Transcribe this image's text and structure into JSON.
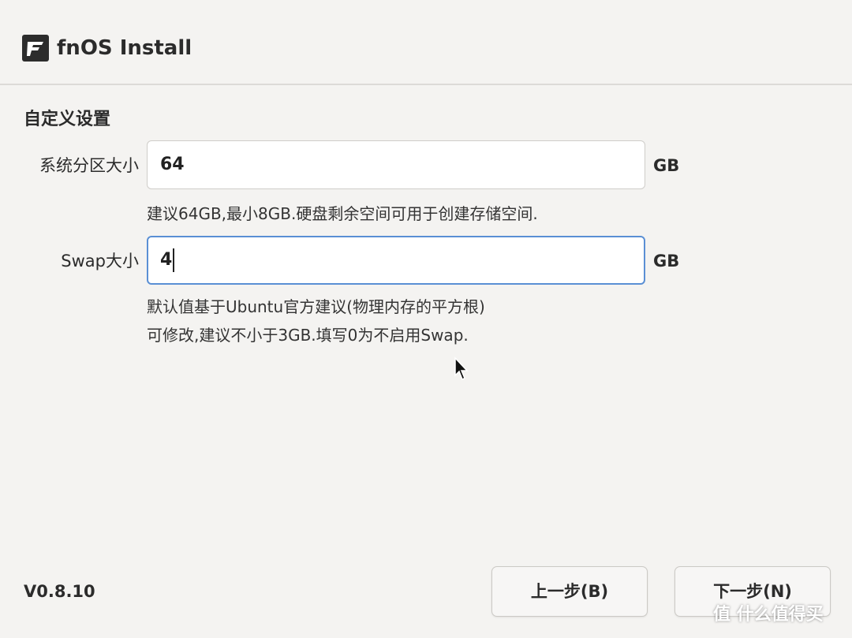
{
  "window": {
    "title": "fnOS Install"
  },
  "section": {
    "title": "自定义设置"
  },
  "system_partition": {
    "label": "系统分区大小",
    "value": "64",
    "unit": "GB",
    "hint": "建议64GB,最小8GB.硬盘剩余空间可用于创建存储空间."
  },
  "swap": {
    "label": "Swap大小",
    "value": "4",
    "unit": "GB",
    "hint_line1": "默认值基于Ubuntu官方建议(物理内存的平方根)",
    "hint_line2": "可修改,建议不小于3GB.填写0为不启用Swap."
  },
  "footer": {
    "version": "V0.8.10",
    "prev_label": "上一步(B)",
    "next_label": "下一步(N)"
  },
  "watermark": {
    "text": "值 什么值得买"
  },
  "icons": {
    "app_logo": "fnos-logo-icon",
    "pointer": "mouse-pointer-icon"
  }
}
